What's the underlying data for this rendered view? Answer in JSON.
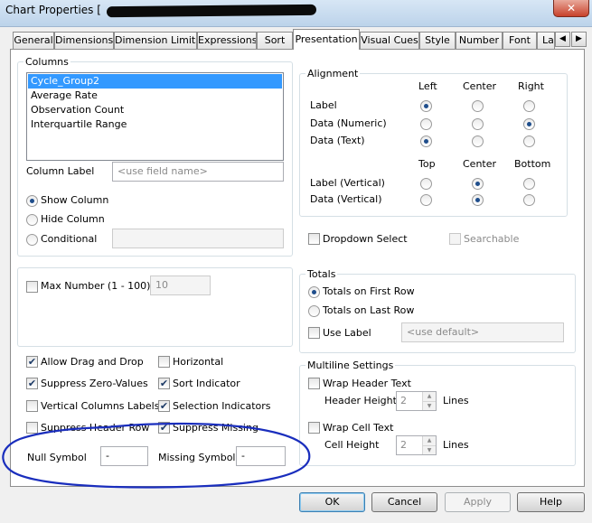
{
  "window": {
    "title": "Chart Properties [",
    "close_glyph": "✕"
  },
  "tabs": [
    {
      "label": "General"
    },
    {
      "label": "Dimensions"
    },
    {
      "label": "Dimension Limits"
    },
    {
      "label": "Expressions"
    },
    {
      "label": "Sort"
    },
    {
      "label": "Presentation",
      "active": true
    },
    {
      "label": "Visual Cues"
    },
    {
      "label": "Style"
    },
    {
      "label": "Number"
    },
    {
      "label": "Font"
    },
    {
      "label": "La"
    }
  ],
  "tab_scroll": {
    "left": "◀",
    "right": "▶"
  },
  "columns": {
    "title": "Columns",
    "items": [
      "Cycle_Group2",
      "Average Rate",
      "Observation Count",
      "Interquartile Range"
    ],
    "selected": "Cycle_Group2",
    "column_label": "Column Label",
    "column_label_placeholder": "<use field name>",
    "show_column": "Show Column",
    "hide_column": "Hide Column",
    "conditional": "Conditional",
    "visibility": "Show Column"
  },
  "alignment": {
    "title": "Alignment",
    "h_headers": [
      "Left",
      "Center",
      "Right"
    ],
    "v_headers": [
      "Top",
      "Center",
      "Bottom"
    ],
    "rows": [
      {
        "label": "Label",
        "selected": "Left"
      },
      {
        "label": "Data (Numeric)",
        "selected": "Right"
      },
      {
        "label": "Data (Text)",
        "selected": "Left"
      }
    ],
    "vrows": [
      {
        "label": "Label (Vertical)",
        "selected": "Center"
      },
      {
        "label": "Data (Vertical)",
        "selected": "Center"
      }
    ]
  },
  "dropdown_select": {
    "label": "Dropdown Select",
    "checked": false
  },
  "searchable": {
    "label": "Searchable",
    "checked": false
  },
  "max_number": {
    "label": "Max Number (1 - 100)",
    "value": "10",
    "checked": false
  },
  "totals": {
    "title": "Totals",
    "first_row": "Totals on First Row",
    "last_row": "Totals on Last Row",
    "selected": "Totals on First Row",
    "use_label": "Use Label",
    "use_label_placeholder": "<use default>"
  },
  "options": {
    "allow_drag_drop": {
      "label": "Allow Drag and Drop",
      "checked": true
    },
    "horizontal": {
      "label": "Horizontal",
      "checked": false
    },
    "suppress_zero": {
      "label": "Suppress Zero-Values",
      "checked": true
    },
    "sort_indicator": {
      "label": "Sort Indicator",
      "checked": true
    },
    "vertical_columns": {
      "label": "Vertical Columns Labels",
      "checked": false
    },
    "selection_indicators": {
      "label": "Selection Indicators",
      "checked": true
    },
    "suppress_header": {
      "label": "Suppress Header Row",
      "checked": false
    },
    "suppress_missing": {
      "label": "Suppress Missing",
      "checked": true
    }
  },
  "symbols": {
    "null_label": "Null Symbol",
    "null_value": "-",
    "missing_label": "Missing Symbol",
    "missing_value": "-"
  },
  "multiline": {
    "title": "Multiline Settings",
    "wrap_header": "Wrap Header Text",
    "header_height": "Header Height",
    "header_value": "2",
    "wrap_cell": "Wrap Cell Text",
    "cell_height": "Cell Height",
    "cell_value": "2",
    "lines": "Lines"
  },
  "buttons": {
    "ok": "OK",
    "cancel": "Cancel",
    "apply": "Apply",
    "help": "Help"
  },
  "icons": {
    "check": "✔",
    "spin_up": "▲",
    "spin_down": "▼"
  },
  "colors": {
    "selection": "#3399ff",
    "annotation": "#1a2ebd"
  }
}
